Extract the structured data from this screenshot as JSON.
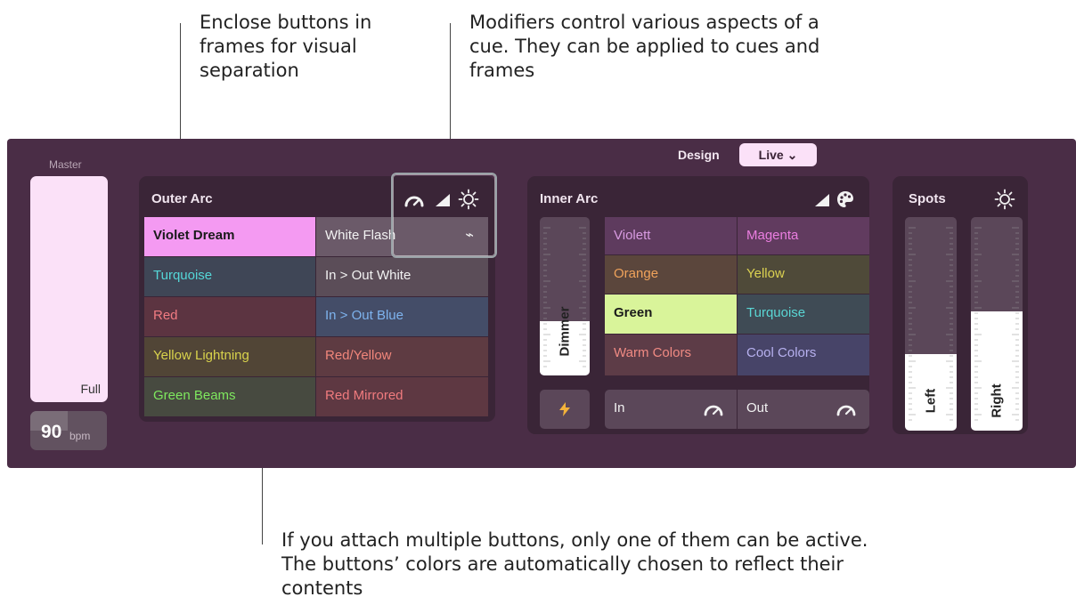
{
  "annotations": {
    "frames_note": [
      "Enclose buttons in",
      "frames for visual",
      "separation"
    ],
    "modifiers_note": [
      "Modifiers control various aspects of a",
      "cue. They can be applied to cues and",
      "frames"
    ],
    "attach_note": [
      "If you attach multiple buttons, only one of them can be active.",
      "The buttons’ colors are automatically chosen to reflect their",
      "contents"
    ]
  },
  "master": {
    "label": "Master",
    "fader_label": "Full",
    "bpm_value": "90",
    "bpm_unit": "bpm"
  },
  "mode": {
    "design_label": "Design",
    "live_label": "Live ⌄"
  },
  "outer_arc": {
    "title": "Outer Arc",
    "modifier_icons": [
      "speed-gauge-icon",
      "dimmer-ramp-icon",
      "brightness-sun-icon"
    ],
    "buttons": [
      {
        "label": "Violet Dream",
        "bg": "#f49af2",
        "fg": "#1a1a1a"
      },
      {
        "label": "White Flash",
        "bg": "#6b5a69",
        "fg": "#f2f2f2",
        "trail_icon": "strobe-pulse-icon",
        "trail": "⌁"
      },
      {
        "label": "Turquoise",
        "bg": "#3f4656",
        "fg": "#55d7d8"
      },
      {
        "label": "In > Out White",
        "bg": "#5b4d58",
        "fg": "#f2f2f2"
      },
      {
        "label": "Red",
        "bg": "#5c3441",
        "fg": "#f17b82"
      },
      {
        "label": "In > Out Blue",
        "bg": "#444d68",
        "fg": "#7eb3ee"
      },
      {
        "label": "Yellow Lightning",
        "bg": "#514536",
        "fg": "#d9d34c"
      },
      {
        "label": "Red/Yellow",
        "bg": "#5e3b42",
        "fg": "#f1867b"
      },
      {
        "label": "Green Beams",
        "bg": "#474a40",
        "fg": "#7ee85e"
      },
      {
        "label": "Red Mirrored",
        "bg": "#5e3842",
        "fg": "#f07b7e"
      }
    ]
  },
  "inner_arc": {
    "title": "Inner Arc",
    "modifier_icons": [
      "dimmer-ramp-icon",
      "color-palette-icon"
    ],
    "dimmer_label": "Dimmer",
    "dimmer_level": 0.34,
    "buttons": [
      {
        "label": "Violett",
        "bg": "#5e3b5e",
        "fg": "#d89be1"
      },
      {
        "label": "Magenta",
        "bg": "#613b5f",
        "fg": "#ea7ee0"
      },
      {
        "label": "Orange",
        "bg": "#5b463c",
        "fg": "#f0a35b"
      },
      {
        "label": "Yellow",
        "bg": "#4f4a39",
        "fg": "#dbd151"
      },
      {
        "label": "Green",
        "bg": "#d9f49a",
        "fg": "#1a1a1a"
      },
      {
        "label": "Turquoise",
        "bg": "#3f4b55",
        "fg": "#5ad6d4"
      },
      {
        "label": "Warm Colors",
        "bg": "#5d3c47",
        "fg": "#f08a83"
      },
      {
        "label": "Cool Colors",
        "bg": "#474468",
        "fg": "#b7b1ef"
      }
    ],
    "flash_icon": "lightning-bolt-icon",
    "in_label": "In",
    "out_label": "Out"
  },
  "spots": {
    "title": "Spots",
    "modifier_icon": "brightness-sun-icon",
    "faders": [
      {
        "label": "Left",
        "level": 0.36
      },
      {
        "label": "Right",
        "level": 0.56
      }
    ]
  }
}
